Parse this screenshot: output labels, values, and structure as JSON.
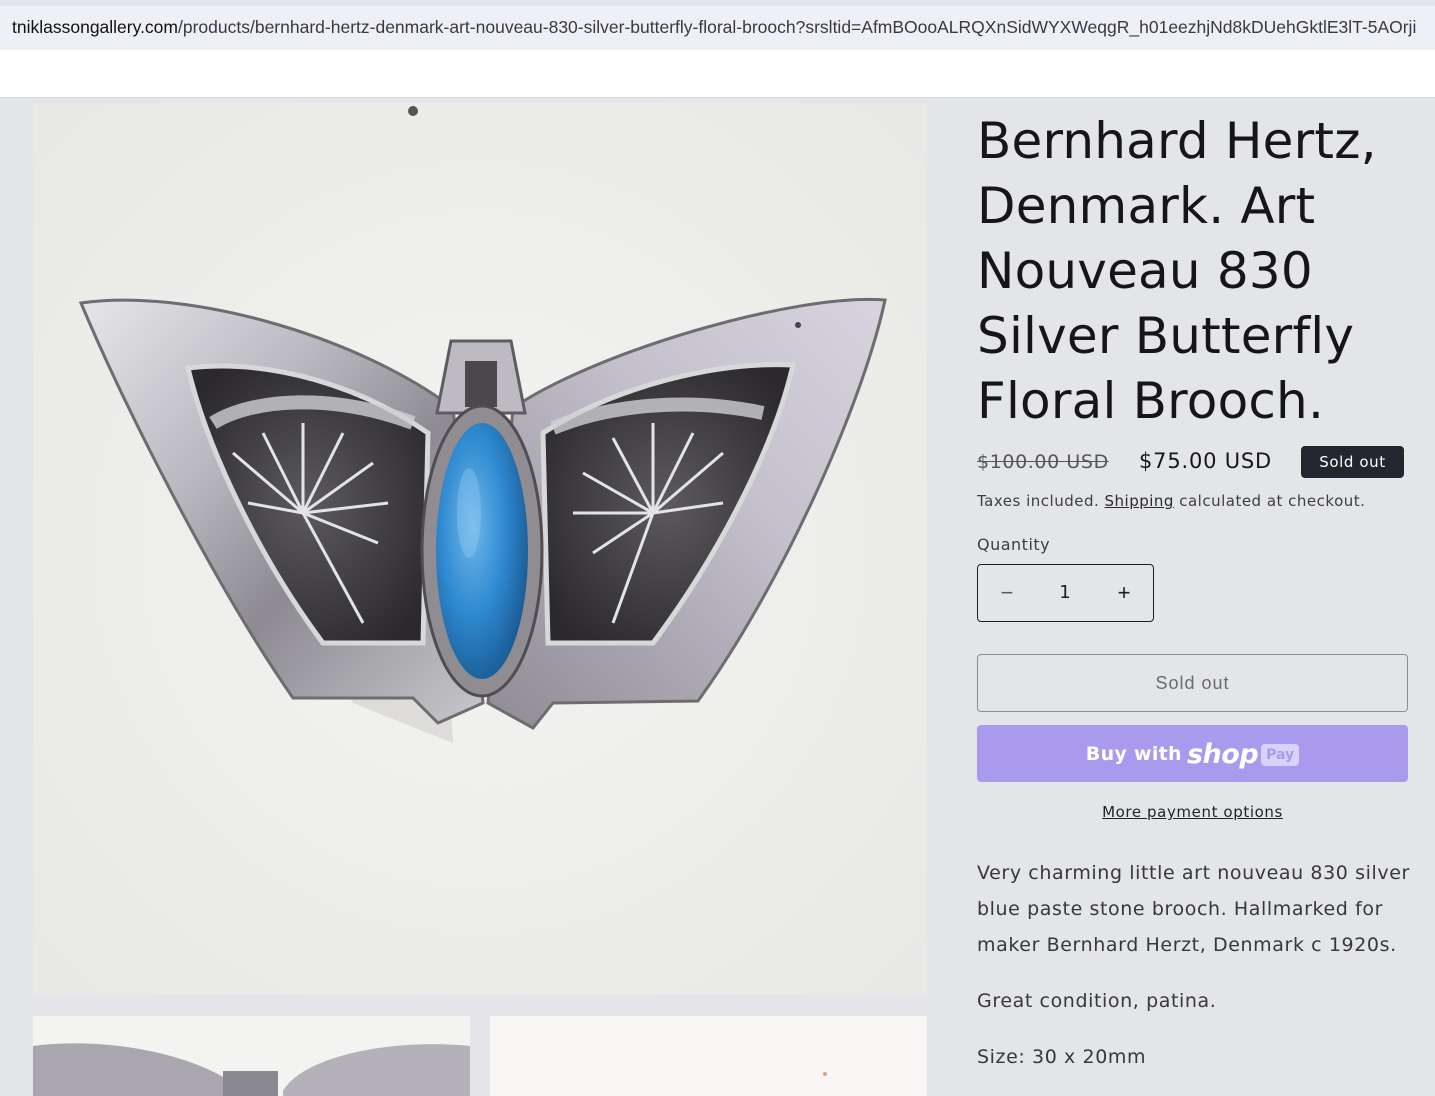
{
  "browser": {
    "url_host": "tniklassongallery.com",
    "url_path": "/products/bernhard-hertz-denmark-art-nouveau-830-silver-butterfly-floral-brooch?srsltid=AfmBOooALRQXnSidWYXWeqgR_h01eezhjNd8kDUehGktlE3lT-5AOrji"
  },
  "product": {
    "title": "Bernhard Hertz, Denmark. Art Nouveau 830 Silver Butterfly Floral Brooch.",
    "price_regular": "$100.00 USD",
    "price_sale": "$75.00 USD",
    "badge": "Sold out",
    "tax_prefix": "Taxes included. ",
    "shipping_link": "Shipping",
    "tax_suffix": " calculated at checkout.",
    "quantity_label": "Quantity",
    "quantity_value": "1",
    "minus_symbol": "−",
    "plus_symbol": "+",
    "sold_out_button": "Sold out",
    "buy_with": "Buy with",
    "shop_logo": "shop",
    "pay_badge": "Pay",
    "more_payment": "More payment options",
    "description": [
      "Very charming little art nouveau 830 silver blue paste stone brooch. Hallmarked for maker Bernhard Herzt, Denmark c 1920s.",
      "Great condition, patina.",
      "Size: 30 x 20mm"
    ]
  },
  "colors": {
    "page_bg": "#e3e5e9",
    "badge_bg": "#23262e",
    "shop_pay": "#a99aee",
    "stone_blue": "#2f8ad0"
  },
  "icons": {
    "minus": "minus-icon",
    "plus": "plus-icon"
  }
}
